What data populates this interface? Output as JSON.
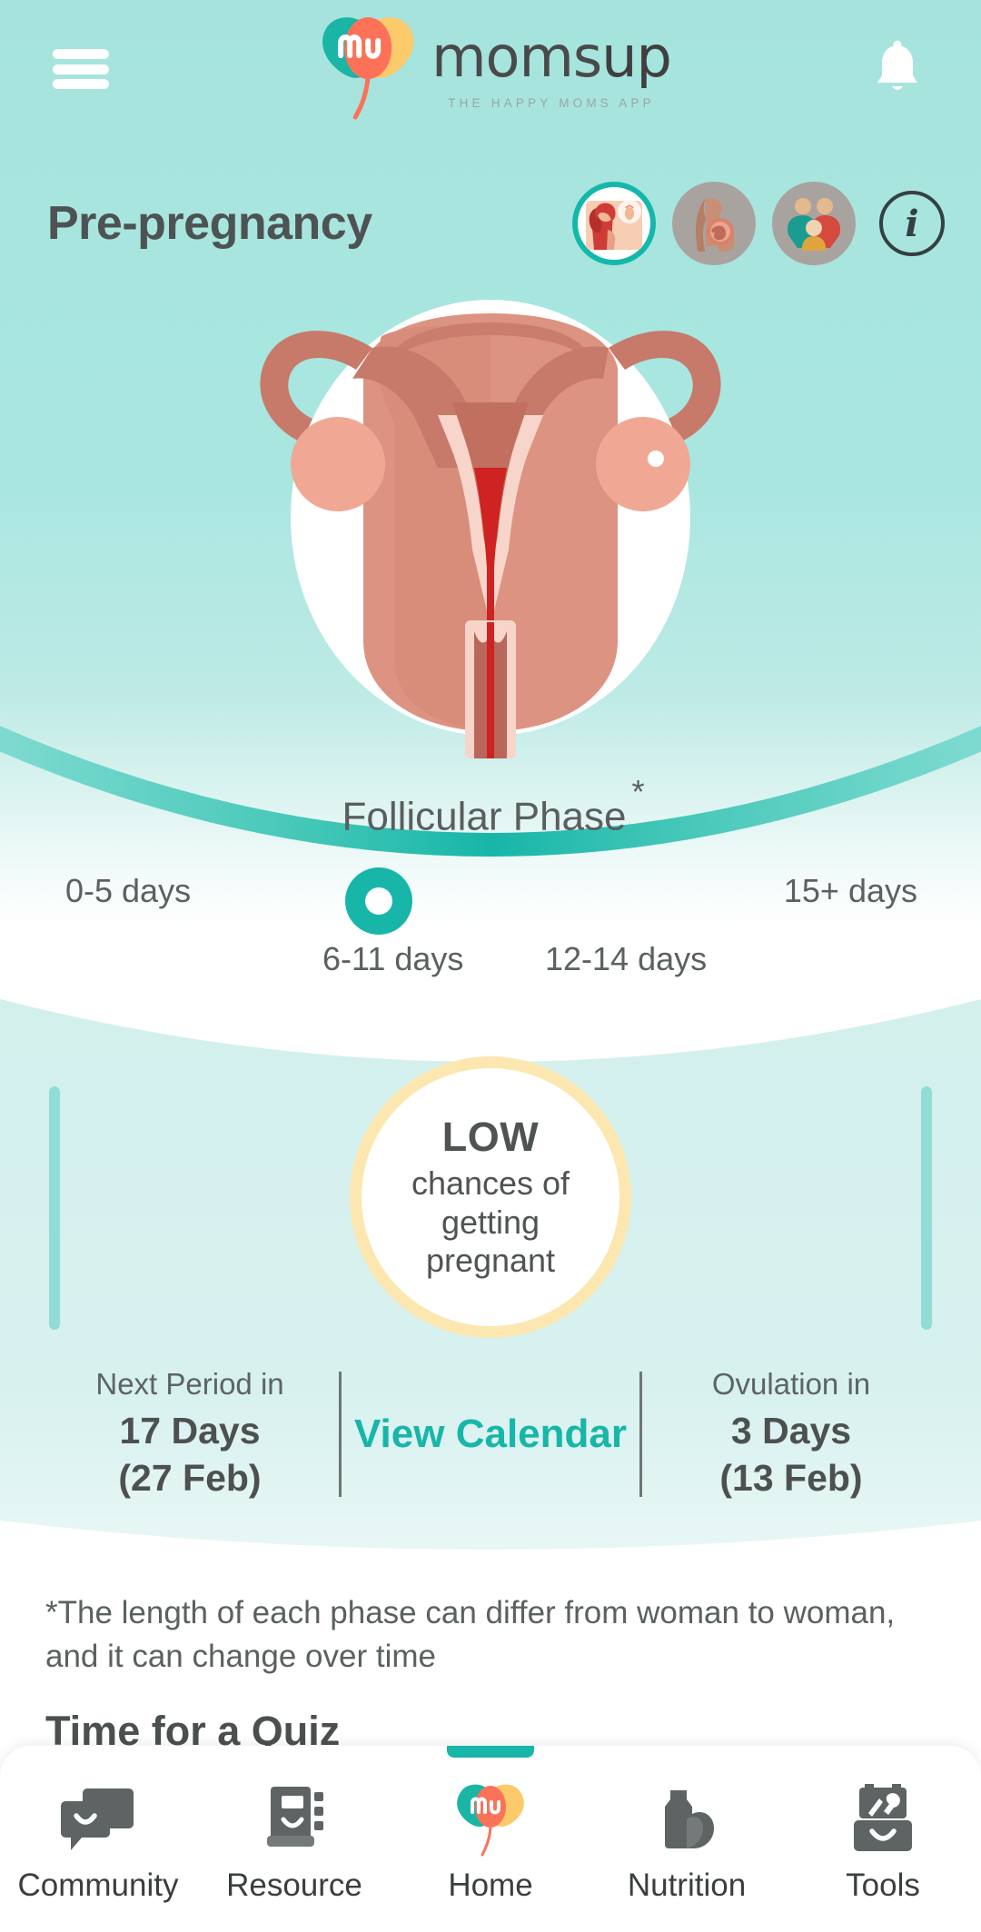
{
  "app": {
    "logo_word_1": "moms",
    "logo_word_2": "up",
    "tagline": "THE HAPPY MOMS APP"
  },
  "header": {
    "menu_icon": "hamburger-menu-icon",
    "bell_icon": "notification-bell-icon"
  },
  "stage": {
    "title": "Pre-pregnancy",
    "buttons": [
      {
        "name": "pre-pregnancy",
        "selected": true
      },
      {
        "name": "pregnancy",
        "selected": false
      },
      {
        "name": "parenting",
        "selected": false
      }
    ],
    "info_label": "i"
  },
  "cycle": {
    "phase_name": "Follicular Phase",
    "phase_asterisk": "*",
    "labels": {
      "left": "0-5 days",
      "center_1": "6-11 days",
      "center_2": "12-14 days",
      "right": "15+ days"
    }
  },
  "fertility": {
    "level": "LOW",
    "description_line_1": "chances of",
    "description_line_2": "getting",
    "description_line_3": "pregnant",
    "next_period_label": "Next Period in",
    "next_period_days": "17 Days",
    "next_period_date": "(27 Feb)",
    "calendar_link": "View Calendar",
    "ovulation_label": "Ovulation in",
    "ovulation_days": "3 Days",
    "ovulation_date": "(13 Feb)"
  },
  "footnote": "*The length of each phase can differ from woman to woman, and it can change over time",
  "quiz": {
    "title": "Time for a Quiz"
  },
  "bottom_nav": {
    "items": [
      {
        "label": "Community",
        "icon": "chat-bubbles-icon",
        "active": false
      },
      {
        "label": "Resource",
        "icon": "book-icon",
        "active": false
      },
      {
        "label": "Home",
        "icon": "momsup-logo-icon",
        "active": true
      },
      {
        "label": "Nutrition",
        "icon": "milk-food-icon",
        "active": false
      },
      {
        "label": "Tools",
        "icon": "toolbox-icon",
        "active": false
      }
    ]
  },
  "colors": {
    "brand_teal": "#17b6a8",
    "background_mint": "#a6e3dd",
    "card_mint": "#d6f0ee",
    "ring_yellow": "#fde7b0",
    "text_dark": "#4d5352"
  }
}
